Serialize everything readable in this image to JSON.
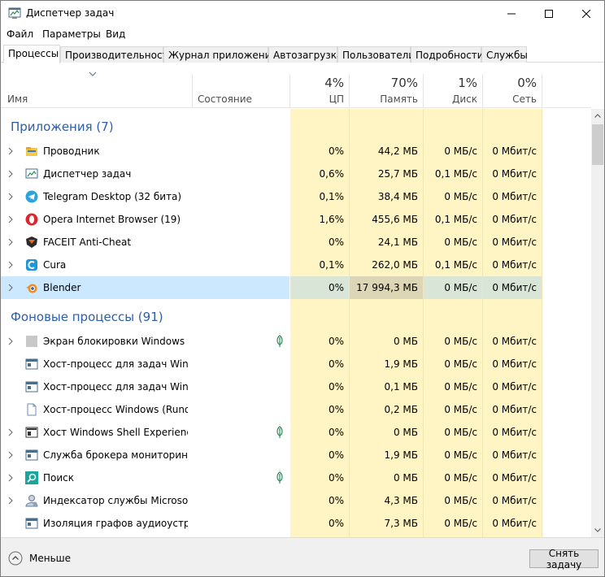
{
  "window": {
    "title": "Диспетчер задач"
  },
  "menu": [
    "Файл",
    "Параметры",
    "Вид"
  ],
  "tabs": [
    "Процессы",
    "Производительность",
    "Журнал приложений",
    "Автозагрузка",
    "Пользователи",
    "Подробности",
    "Службы"
  ],
  "header": {
    "name": "Имя",
    "status": "Состояние",
    "metrics": [
      {
        "pct": "4%",
        "label": "ЦП"
      },
      {
        "pct": "70%",
        "label": "Память"
      },
      {
        "pct": "1%",
        "label": "Диск"
      },
      {
        "pct": "0%",
        "label": "Сеть"
      }
    ]
  },
  "groups": {
    "apps": "Приложения (7)",
    "background": "Фоновые процессы (91)"
  },
  "apps": [
    {
      "name": "Проводник",
      "icon": "explorer-icon",
      "cpu": "0%",
      "mem": "44,2 МБ",
      "disk": "0 МБ/с",
      "net": "0 Мбит/с"
    },
    {
      "name": "Диспетчер задач",
      "icon": "task-manager-icon",
      "cpu": "0,6%",
      "mem": "25,7 МБ",
      "disk": "0,1 МБ/с",
      "net": "0 Мбит/с"
    },
    {
      "name": "Telegram Desktop (32 бита)",
      "icon": "telegram-icon",
      "cpu": "0,1%",
      "mem": "38,4 МБ",
      "disk": "0 МБ/с",
      "net": "0 Мбит/с"
    },
    {
      "name": "Opera Internet Browser (19)",
      "icon": "opera-icon",
      "cpu": "1,6%",
      "mem": "455,6 МБ",
      "disk": "0,1 МБ/с",
      "net": "0 Мбит/с"
    },
    {
      "name": "FACEIT Anti-Cheat",
      "icon": "faceit-icon",
      "cpu": "0%",
      "mem": "24,1 МБ",
      "disk": "0 МБ/с",
      "net": "0 Мбит/с"
    },
    {
      "name": "Cura",
      "icon": "cura-icon",
      "cpu": "0,1%",
      "mem": "262,0 МБ",
      "disk": "0,1 МБ/с",
      "net": "0 Мбит/с"
    },
    {
      "name": "Blender",
      "icon": "blender-icon",
      "cpu": "0%",
      "mem": "17 994,3 МБ",
      "disk": "0 МБ/с",
      "net": "0 Мбит/с"
    }
  ],
  "background": [
    {
      "name": "Экран блокировки Windows п...",
      "icon": "lock-screen-icon",
      "cpu": "0%",
      "mem": "0 МБ",
      "disk": "0 МБ/с",
      "net": "0 Мбит/с"
    },
    {
      "name": "Хост-процесс для задач Windo...",
      "icon": "host-process-icon",
      "cpu": "0%",
      "mem": "1,9 МБ",
      "disk": "0 МБ/с",
      "net": "0 Мбит/с"
    },
    {
      "name": "Хост-процесс для задач Windo...",
      "icon": "host-process-icon",
      "cpu": "0%",
      "mem": "0,1 МБ",
      "disk": "0 МБ/с",
      "net": "0 Мбит/с"
    },
    {
      "name": "Хост-процесс Windows (Rundll...",
      "icon": "rundll-icon",
      "cpu": "0%",
      "mem": "0,2 МБ",
      "disk": "0 МБ/с",
      "net": "0 Мбит/с"
    },
    {
      "name": "Хост Windows Shell Experience",
      "icon": "shell-experience-icon",
      "cpu": "0%",
      "mem": "0 МБ",
      "disk": "0 МБ/с",
      "net": "0 Мбит/с"
    },
    {
      "name": "Служба брокера мониторинга...",
      "icon": "broker-service-icon",
      "cpu": "0%",
      "mem": "1,9 МБ",
      "disk": "0 МБ/с",
      "net": "0 Мбит/с"
    },
    {
      "name": "Поиск",
      "icon": "search-icon",
      "cpu": "0%",
      "mem": "0 МБ",
      "disk": "0 МБ/с",
      "net": "0 Мбит/с"
    },
    {
      "name": "Индексатор службы Microsoft ...",
      "icon": "indexer-icon",
      "cpu": "0%",
      "mem": "4,3 МБ",
      "disk": "0 МБ/с",
      "net": "0 Мбит/с"
    },
    {
      "name": "Изоляция графов аудиоустро...",
      "icon": "audio-isolation-icon",
      "cpu": "0%",
      "mem": "7,3 МБ",
      "disk": "0 МБ/с",
      "net": "0 Мбит/с"
    }
  ],
  "footer": {
    "fewer": "Меньше",
    "end_task": "Снять задачу"
  }
}
